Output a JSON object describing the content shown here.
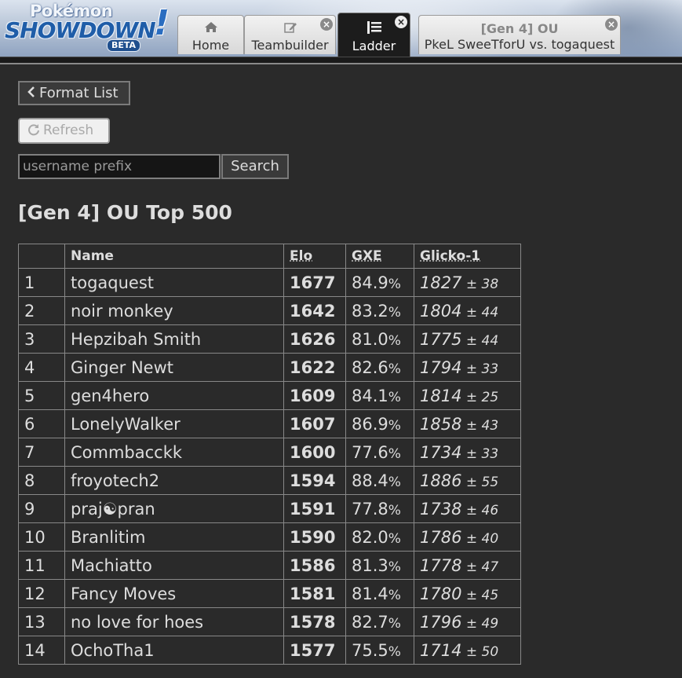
{
  "logo": {
    "line1": "Pokémon",
    "line2": "SHOWDOWN",
    "badge": "BETA",
    "bang": "!"
  },
  "tabs": [
    {
      "label": "Home",
      "icon": "home-icon"
    },
    {
      "label": "Teambuilder",
      "icon": "edit-icon",
      "closable": true
    },
    {
      "label": "Ladder",
      "icon": "list-icon",
      "closable": true,
      "active": true
    },
    {
      "format": "[Gen 4] OU",
      "label": "PkeL SweeTforU vs. togaquest",
      "closable": true
    }
  ],
  "controls": {
    "format_list": "Format List",
    "refresh": "Refresh",
    "search_placeholder": "username prefix",
    "search_button": "Search"
  },
  "page_title": "[Gen 4] OU Top 500",
  "table": {
    "headers": [
      "",
      "Name",
      "Elo",
      "GXE",
      "Glicko-1"
    ],
    "rows": [
      {
        "rank": "1",
        "name": "togaquest",
        "elo": "1677",
        "gxe": "84.9",
        "glicko": "1827",
        "dev": "38"
      },
      {
        "rank": "2",
        "name": "noir monkey",
        "elo": "1642",
        "gxe": "83.2",
        "glicko": "1804",
        "dev": "44"
      },
      {
        "rank": "3",
        "name": "Hepzibah Smith",
        "elo": "1626",
        "gxe": "81.0",
        "glicko": "1775",
        "dev": "44"
      },
      {
        "rank": "4",
        "name": "Ginger Newt",
        "elo": "1622",
        "gxe": "82.6",
        "glicko": "1794",
        "dev": "33"
      },
      {
        "rank": "5",
        "name": "gen4hero",
        "elo": "1609",
        "gxe": "84.1",
        "glicko": "1814",
        "dev": "25"
      },
      {
        "rank": "6",
        "name": "LonelyWalker",
        "elo": "1607",
        "gxe": "86.9",
        "glicko": "1858",
        "dev": "43"
      },
      {
        "rank": "7",
        "name": "Commbacckk",
        "elo": "1600",
        "gxe": "77.6",
        "glicko": "1734",
        "dev": "33"
      },
      {
        "rank": "8",
        "name": "froyotech2",
        "elo": "1594",
        "gxe": "88.4",
        "glicko": "1886",
        "dev": "55"
      },
      {
        "rank": "9",
        "name": "praj☯pran",
        "elo": "1591",
        "gxe": "77.8",
        "glicko": "1738",
        "dev": "46"
      },
      {
        "rank": "10",
        "name": "Branlitim",
        "elo": "1590",
        "gxe": "82.0",
        "glicko": "1786",
        "dev": "40"
      },
      {
        "rank": "11",
        "name": "Machiatto",
        "elo": "1586",
        "gxe": "81.3",
        "glicko": "1778",
        "dev": "47"
      },
      {
        "rank": "12",
        "name": "Fancy Moves",
        "elo": "1581",
        "gxe": "81.4",
        "glicko": "1780",
        "dev": "45"
      },
      {
        "rank": "13",
        "name": "no love for hoes",
        "elo": "1578",
        "gxe": "82.7",
        "glicko": "1796",
        "dev": "49"
      },
      {
        "rank": "14",
        "name": "OchoTha1",
        "elo": "1577",
        "gxe": "75.5",
        "glicko": "1714",
        "dev": "50"
      }
    ]
  }
}
